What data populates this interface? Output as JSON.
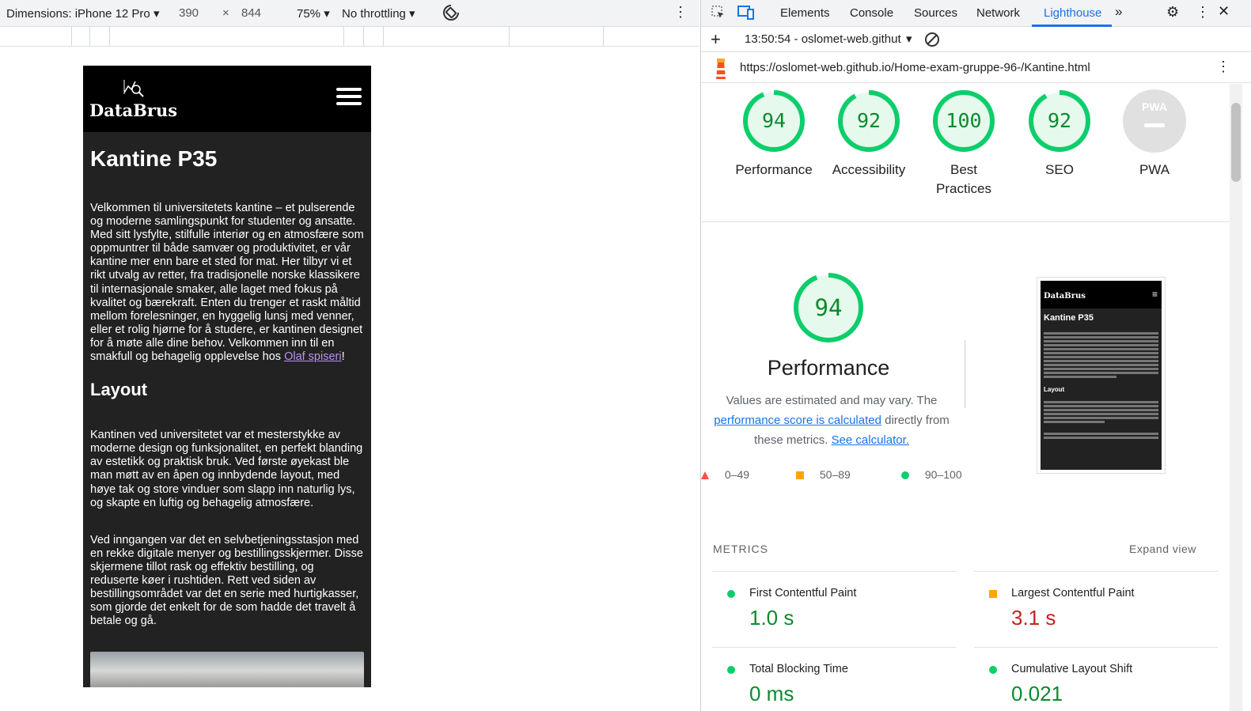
{
  "device_toolbar": {
    "dimensions": "Dimensions: iPhone 12 Pro",
    "width": "390",
    "times": "×",
    "height": "844",
    "zoom": "75%",
    "throttling": "No throttling"
  },
  "phone": {
    "brand": "DataBrus",
    "heading": "Kantine P35",
    "intro": "Velkommen til universitetets kantine – et pulserende og moderne samlingspunkt for studenter og ansatte. Med sitt lysfylte, stilfulle interiør og en atmosfære som oppmuntrer til både samvær og produktivitet, er vår kantine mer enn bare et sted for mat. Her tilbyr vi et rikt utvalg av retter, fra tradisjonelle norske klassikere til internasjonale smaker, alle laget med fokus på kvalitet og bærekraft. Enten du trenger et raskt måltid mellom forelesninger, en hyggelig lunsj med venner, eller et rolig hjørne for å studere, er kantinen designet for å møte alle dine behov. Velkommen inn til en smakfull og behagelig opplevelse hos ",
    "intro_link": "Olaf spiseri",
    "intro_end": "!",
    "layout_heading": "Layout",
    "layout_p1": "Kantinen ved universitetet var et mesterstykke av moderne design og funksjonalitet, en perfekt blanding av estetikk og praktisk bruk. Ved første øyekast ble man møtt av en åpen og innbydende layout, med høye tak og store vinduer som slapp inn naturlig lys, og skapte en luftig og behagelig atmosfære.",
    "layout_p2": "Ved inngangen var det en selvbetjeningsstasjon med en rekke digitale menyer og bestillingsskjermer. Disse skjermene tillot rask og effektiv bestilling, og reduserte køer i rushtiden. Rett ved siden av bestillingsområdet var det en serie med hurtigkasser, som gjorde det enkelt for de som hadde det travelt å betale og gå."
  },
  "devtools": {
    "tabs": [
      "Elements",
      "Console",
      "Sources",
      "Network",
      "Lighthouse"
    ],
    "active_tab": "Lighthouse",
    "report_time": "13:50:54 - oslomet-web.githut",
    "url": "https://oslomet-web.github.io/Home-exam-gruppe-96-/Kantine.html"
  },
  "scores": [
    {
      "label": "Performance",
      "value": "94",
      "fraction": 0.94
    },
    {
      "label": "Accessibility",
      "value": "92",
      "fraction": 0.92
    },
    {
      "label": "Best Practices",
      "value": "100",
      "fraction": 1.0
    },
    {
      "label": "SEO",
      "value": "92",
      "fraction": 0.92
    }
  ],
  "pwa": {
    "label": "PWA",
    "badge": "PWA"
  },
  "performance": {
    "score": "94",
    "title": "Performance",
    "desc_1": "Values are estimated and may vary. The",
    "desc_link": "performance score is calculated",
    "desc_2": " directly from these metrics. ",
    "desc_calc": "See calculator.",
    "legend": [
      "0–49",
      "50–89",
      "90–100"
    ]
  },
  "metrics": {
    "label": "METRICS",
    "expand": "Expand view",
    "items": [
      {
        "name": "First Contentful Paint",
        "value": "1.0 s",
        "color": "#0c8a2e"
      },
      {
        "name": "Largest Contentful Paint",
        "value": "3.1 s",
        "color": "#c5221f"
      },
      {
        "name": "Total Blocking Time",
        "value": "0 ms",
        "color": "#0c8a2e"
      },
      {
        "name": "Cumulative Layout Shift",
        "value": "0.021",
        "color": "#0c8a2e"
      }
    ]
  },
  "colors": {
    "pass": "#0cce6b",
    "average": "#ffa400",
    "fail": "#ff4e42",
    "accent": "#1a73e8"
  }
}
